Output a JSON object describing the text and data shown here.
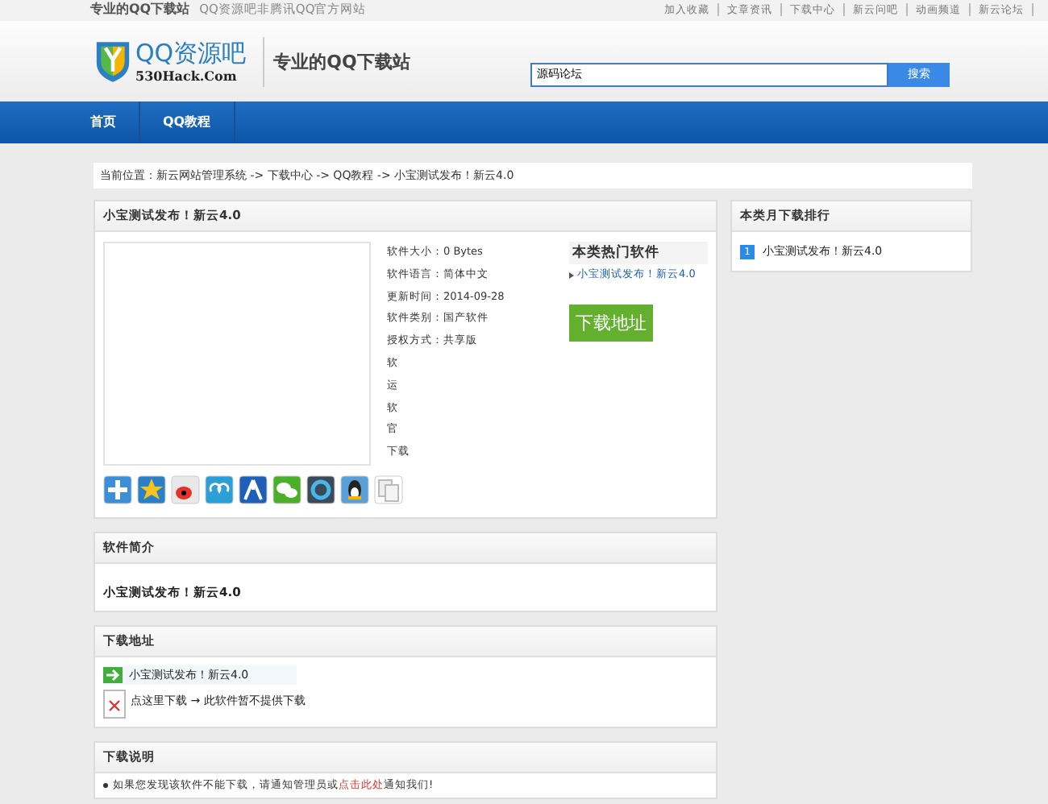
{
  "top_bar": {
    "tagline": "专业的QQ下载站",
    "tagline_note": "QQ资源吧非腾讯QQ官方网站",
    "links": [
      "加入收藏",
      "文章资讯",
      "下载中心",
      "新云问吧",
      "动画频道",
      "新云论坛"
    ]
  },
  "header": {
    "logo_text": "QQ资源吧",
    "logo_domain": "530Hack.Com",
    "slogan": "专业的QQ下载站",
    "search": {
      "value": "源码论坛",
      "button": "搜索"
    }
  },
  "nav": [
    "首页",
    "QQ教程"
  ],
  "breadcrumb": "当前位置：新云网站管理系统 -> 下载中心 -> QQ教程 -> 小宝测试发布！新云4.0",
  "software": {
    "title": "小宝测试发布！新云4.0",
    "details": [
      {
        "label": "软件大小：",
        "value": "0 Bytes"
      },
      {
        "label": "软件语言：",
        "value": "简体中文"
      },
      {
        "label": "更新时间：",
        "value": "2014-09-28"
      },
      {
        "label": "软件类别：",
        "value": "国产软件"
      },
      {
        "label": "授权方式：",
        "value": "共享版"
      },
      {
        "label": "软"
      },
      {
        "label": "运"
      },
      {
        "label": "软"
      },
      {
        "label": "官"
      },
      {
        "label": "下载"
      }
    ],
    "hot": {
      "title": "本类热门软件",
      "items": [
        "小宝测试发布！新云4.0"
      ]
    },
    "download_button": "下载地址"
  },
  "monthly_ranking": {
    "title": "本类月下载排行",
    "items": [
      {
        "rank": "1",
        "name": "小宝测试发布！新云4.0"
      }
    ]
  },
  "intro": {
    "title": "软件简介",
    "text": "小宝测试发布！新云4.0"
  },
  "download": {
    "title": "下载地址",
    "link": "小宝测试发布！新云4.0",
    "note": "点这里下载 → 此软件暂不提供下载"
  },
  "instructions": {
    "title": "下载说明",
    "text": "如果您发现该软件不能下载，请通知管理员或",
    "link": "点击此处",
    "after": "通知我们!"
  }
}
